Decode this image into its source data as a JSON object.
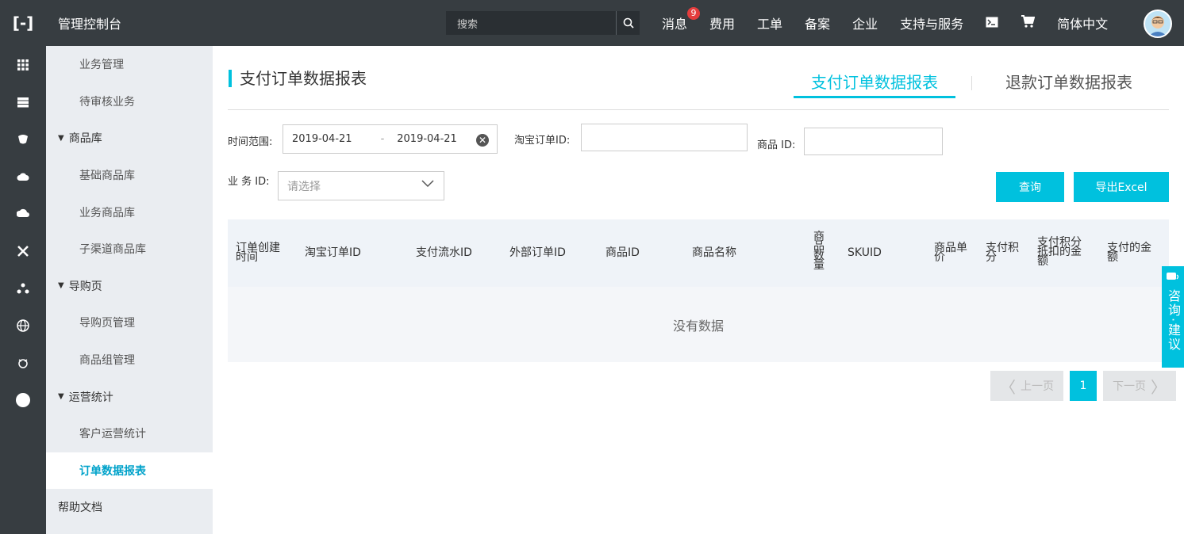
{
  "topbar": {
    "logo": "[-]",
    "title": "管理控制台",
    "search_placeholder": "搜索",
    "nav": [
      {
        "label": "消息",
        "badge": "9"
      },
      {
        "label": "费用"
      },
      {
        "label": "工单"
      },
      {
        "label": "备案"
      },
      {
        "label": "企业"
      },
      {
        "label": "支持与服务"
      }
    ],
    "language": "简体中文"
  },
  "rail_icons": [
    "grid-icon",
    "server-icon",
    "brain-icon",
    "cloud-icon",
    "cloud-alt-icon",
    "cross-icon",
    "cluster-icon",
    "globe-icon",
    "bug-icon",
    "circle-icon"
  ],
  "sidebar": {
    "items": [
      {
        "label": "业务管理",
        "type": "sub"
      },
      {
        "label": "待审核业务",
        "type": "sub"
      },
      {
        "label": "商品库",
        "type": "group"
      },
      {
        "label": "基础商品库",
        "type": "sub"
      },
      {
        "label": "业务商品库",
        "type": "sub"
      },
      {
        "label": "子渠道商品库",
        "type": "sub"
      },
      {
        "label": "导购页",
        "type": "group"
      },
      {
        "label": "导购页管理",
        "type": "sub"
      },
      {
        "label": "商品组管理",
        "type": "sub"
      },
      {
        "label": "运营统计",
        "type": "group"
      },
      {
        "label": "客户运营统计",
        "type": "sub"
      },
      {
        "label": "订单数据报表",
        "type": "active"
      },
      {
        "label": "帮助文档",
        "type": "plain"
      }
    ]
  },
  "main": {
    "title": "支付订单数据报表",
    "tabs": [
      {
        "label": "支付订单数据报表",
        "active": true
      },
      {
        "label": "退款订单数据报表",
        "active": false
      }
    ],
    "filters": {
      "time_label": "时间范围:",
      "date_start": "2019-04-21",
      "date_sep": "-",
      "date_end": "2019-04-21",
      "taobao_label": "淘宝订单ID:",
      "product_label": "商品 ID:",
      "business_label": "业 务 ID:",
      "business_placeholder": "请选择"
    },
    "buttons": {
      "query": "查询",
      "export": "导出Excel"
    },
    "table": {
      "headers": [
        "订单创建时间",
        "淘宝订单ID",
        "支付流水ID",
        "外部订单ID",
        "商品ID",
        "商品名称",
        "商品数量",
        "SKUID",
        "商品单价",
        "支付积分",
        "支付积分抵扣的金额",
        "支付的金额"
      ],
      "empty_text": "没有数据"
    },
    "pagination": {
      "prev": "上一页",
      "current": "1",
      "next": "下一页"
    }
  },
  "float_help": {
    "label": "咨询·建议"
  },
  "colors": {
    "accent": "#00c1de",
    "topbar": "#373d41",
    "sidebar": "#eaedf1"
  }
}
